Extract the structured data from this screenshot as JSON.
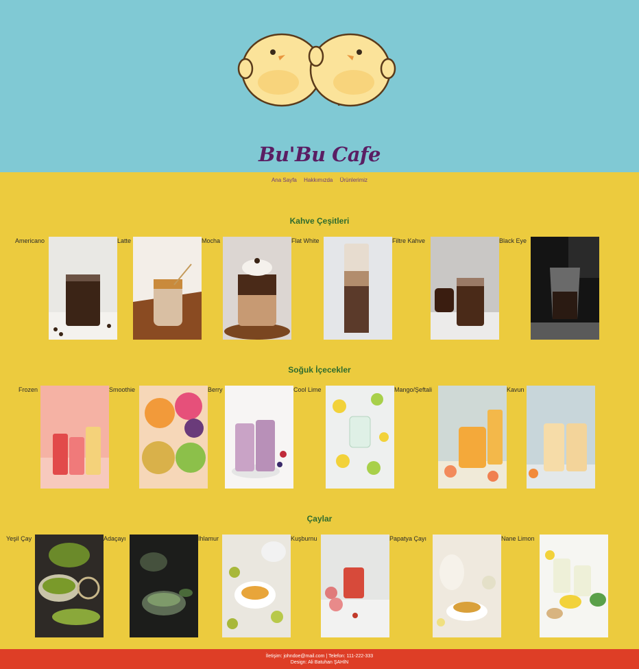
{
  "brand": {
    "name": "Bu'Bu Cafe"
  },
  "nav": {
    "items": [
      "Ana Sayfa",
      "Hakkımızda",
      "Ürünlerimiz"
    ]
  },
  "sections": [
    {
      "title": "Kahve Çeşitleri",
      "items": [
        "Americano",
        "Latte",
        "Mocha",
        "Flat White",
        "Filtre Kahve",
        "Black Eye"
      ]
    },
    {
      "title": "Soğuk İçecekler",
      "items": [
        "Frozen",
        "Smoothie",
        "Berry",
        "Cool Lime",
        "Mango/Şeftali",
        "Kavun"
      ]
    },
    {
      "title": "Çaylar",
      "items": [
        "Yeşil Çay",
        "Adaçayı",
        "Ihlamur",
        "Kuşburnu",
        "Papatya Çayı",
        "Nane Limon"
      ]
    }
  ],
  "footer": {
    "contact": "İletişim: johndoe@mail.com | Telefon: 111-222-333",
    "design": "Design: Ali Batuhan ŞAHİN"
  },
  "colors": {
    "header_bg": "#80C9D4",
    "body_bg": "#ECCB3E",
    "footer_bg": "#DE3E26",
    "brand": "#5A1E63",
    "section_title": "#2E6B2E"
  }
}
